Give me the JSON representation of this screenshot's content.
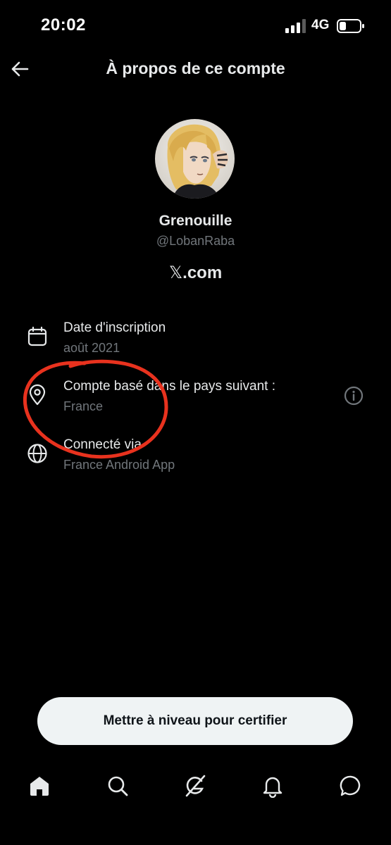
{
  "status_bar": {
    "time": "20:02",
    "network": "4G",
    "signal_icon": "signal-bars-icon",
    "battery_icon": "battery-icon"
  },
  "header": {
    "title": "À propos de ce compte",
    "back_icon": "arrow-left-icon"
  },
  "profile": {
    "display_name": "Grenouille",
    "handle": "@LobanRaba",
    "domain_prefix": "𝕏",
    "domain_suffix": ".com"
  },
  "details": [
    {
      "icon": "calendar-icon",
      "label": "Date d'inscription",
      "value": "août 2021"
    },
    {
      "icon": "location-pin-icon",
      "label": "Compte basé dans le pays suivant :",
      "value": "France",
      "info_icon": "info-circle-icon"
    },
    {
      "icon": "globe-icon",
      "label": "Connecté via",
      "value": "France Android App"
    }
  ],
  "upgrade_button": {
    "label": "Mettre à niveau pour certifier"
  },
  "bottom_nav": [
    {
      "icon": "home-icon"
    },
    {
      "icon": "search-icon"
    },
    {
      "icon": "grok-icon"
    },
    {
      "icon": "bell-icon"
    },
    {
      "icon": "messages-icon"
    }
  ],
  "colors": {
    "background": "#000000",
    "primary_text": "#e7e9ea",
    "secondary_text": "#71767b",
    "annotation": "#e8321e",
    "button_bg": "#eff3f4"
  }
}
